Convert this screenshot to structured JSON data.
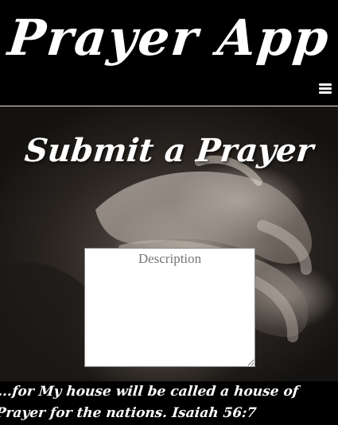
{
  "header": {
    "app_title": "Prayer App",
    "menu_icon": "hamburger-menu-icon"
  },
  "main": {
    "section_title": "Submit a Prayer",
    "description_placeholder": "Description",
    "description_value": ""
  },
  "footer": {
    "verse": "...for My house will be called a house of Prayer for the nations. Isaiah 56:7"
  },
  "colors": {
    "background": "#000000",
    "text": "#ffffff",
    "divider": "#e6e6e6"
  }
}
